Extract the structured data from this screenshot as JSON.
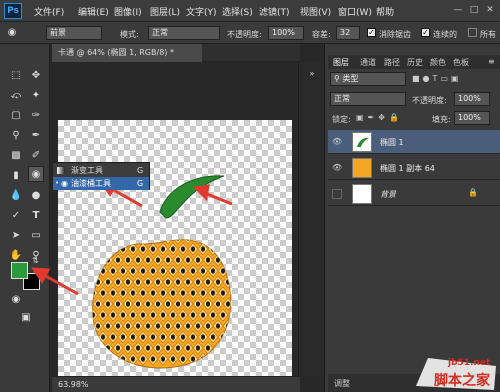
{
  "menubar": {
    "logo": "Ps",
    "items": [
      "文件(F)",
      "编辑(E)",
      "图像(I)",
      "图层(L)",
      "文字(Y)",
      "选择(S)",
      "滤镜(T)",
      "视图(V)",
      "窗口(W)",
      "帮助"
    ]
  },
  "options": {
    "fill_source": "前景",
    "pattern_label": "模式:",
    "mode": "正常",
    "opacity_label": "不透明度:",
    "opacity": "100%",
    "tolerance_label": "容差:",
    "tolerance": "32",
    "antialias_label": "消除锯齿",
    "contiguous_label": "连续的",
    "all_layers_label": "所有"
  },
  "document": {
    "tab_title": "卡通 @ 64% (椭圆 1, RGB/8) *",
    "zoom": "63.98%"
  },
  "flyout": {
    "items": [
      {
        "label": "渐变工具",
        "shortcut": "G"
      },
      {
        "label": "油漆桶工具",
        "shortcut": "G"
      }
    ]
  },
  "panels": {
    "tabs": [
      "图层",
      "通道",
      "路径",
      "历史",
      "颜色",
      "色板"
    ],
    "filter_label": "类型",
    "blend_mode": "正常",
    "opacity_label": "不透明度:",
    "opacity": "100%",
    "lock_label": "锁定:",
    "fill_label": "填充:",
    "fill": "100%",
    "layers": [
      {
        "name": "椭圆 1",
        "selected": true
      },
      {
        "name": "椭圆 1 副本 64",
        "selected": false
      },
      {
        "name": "背景",
        "selected": false
      }
    ],
    "bottom_label": "调整"
  },
  "colors": {
    "accent": "#2a9a3a",
    "stem": "#2a8a2e",
    "fruit": "#f5a623",
    "fruit_light": "#ffd37a",
    "arrow": "#e03a30",
    "panel_bg": "#3a3a3a",
    "selected_layer": "#4a5d7a"
  },
  "watermark": {
    "site": "jb51.net",
    "text": "脚本之家"
  }
}
